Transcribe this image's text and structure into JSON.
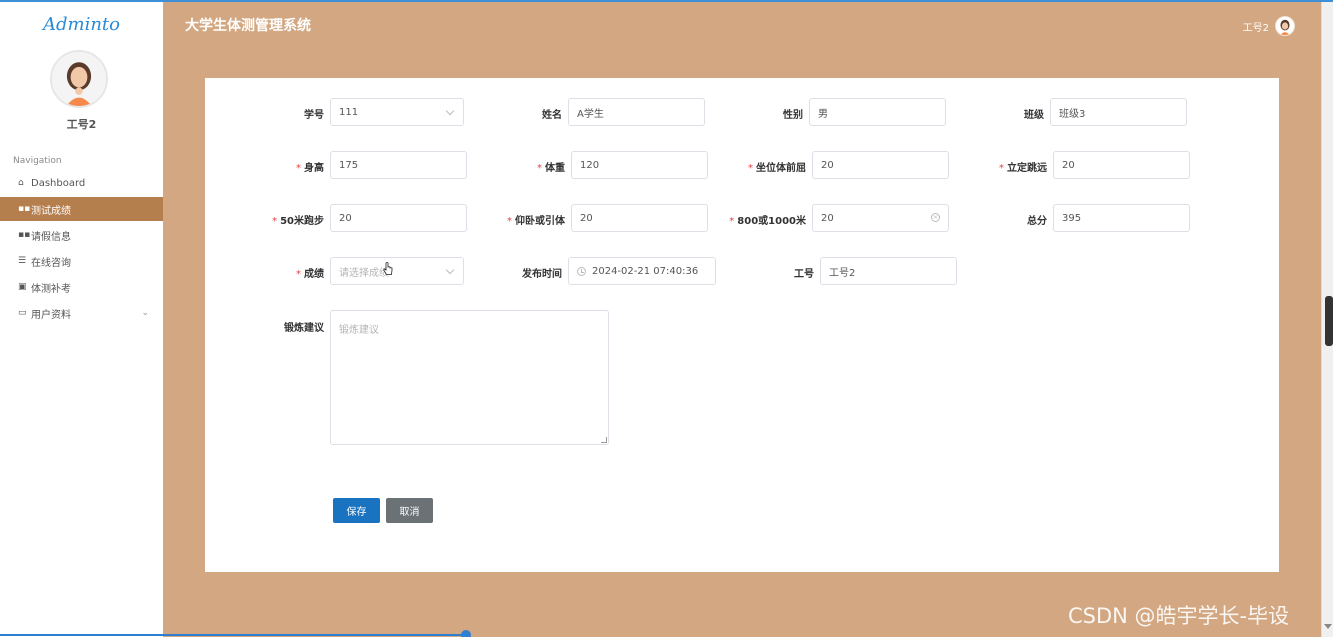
{
  "app": {
    "logo": "Adminto",
    "system_title": "大学生体测管理系统",
    "user": "工号2"
  },
  "sidebar": {
    "username": "工号2",
    "nav_heading": "Navigation",
    "items": [
      {
        "label": "Dashboard",
        "icon": "home-icon"
      },
      {
        "label": "测试成绩",
        "icon": "grid-icon"
      },
      {
        "label": "请假信息",
        "icon": "grid-icon"
      },
      {
        "label": "在线咨询",
        "icon": "list-icon"
      },
      {
        "label": "体测补考",
        "icon": "clipboard-icon"
      },
      {
        "label": "用户资料",
        "icon": "window-icon"
      }
    ]
  },
  "form": {
    "student_id": {
      "label": "学号",
      "value": "111"
    },
    "name": {
      "label": "姓名",
      "value": "A学生"
    },
    "gender": {
      "label": "性别",
      "value": "男"
    },
    "class": {
      "label": "班级",
      "value": "班级3"
    },
    "height": {
      "label": "身高",
      "value": "175"
    },
    "weight": {
      "label": "体重",
      "value": "120"
    },
    "sit_reach": {
      "label": "坐位体前屈",
      "value": "20"
    },
    "long_jump": {
      "label": "立定跳远",
      "value": "20"
    },
    "run50": {
      "label": "50米跑步",
      "value": "20"
    },
    "situps": {
      "label": "仰卧或引体",
      "value": "20"
    },
    "run_long": {
      "label": "800或1000米",
      "value": "20"
    },
    "total": {
      "label": "总分",
      "value": "395"
    },
    "grade": {
      "label": "成绩",
      "placeholder": "请选择成绩"
    },
    "publish_time": {
      "label": "发布时间",
      "value": "2024-02-21 07:40:36"
    },
    "staff_id": {
      "label": "工号",
      "value": "工号2"
    },
    "advice": {
      "label": "锻炼建议",
      "placeholder": "锻炼建议"
    },
    "required_mark": "*",
    "save_label": "保存",
    "cancel_label": "取消"
  },
  "watermark": "CSDN @皓宇学长-毕设",
  "colors": {
    "background": "#d2a781",
    "active_nav": "#b57e4d",
    "primary": "#1a73c0",
    "secondary": "#6a7276"
  }
}
